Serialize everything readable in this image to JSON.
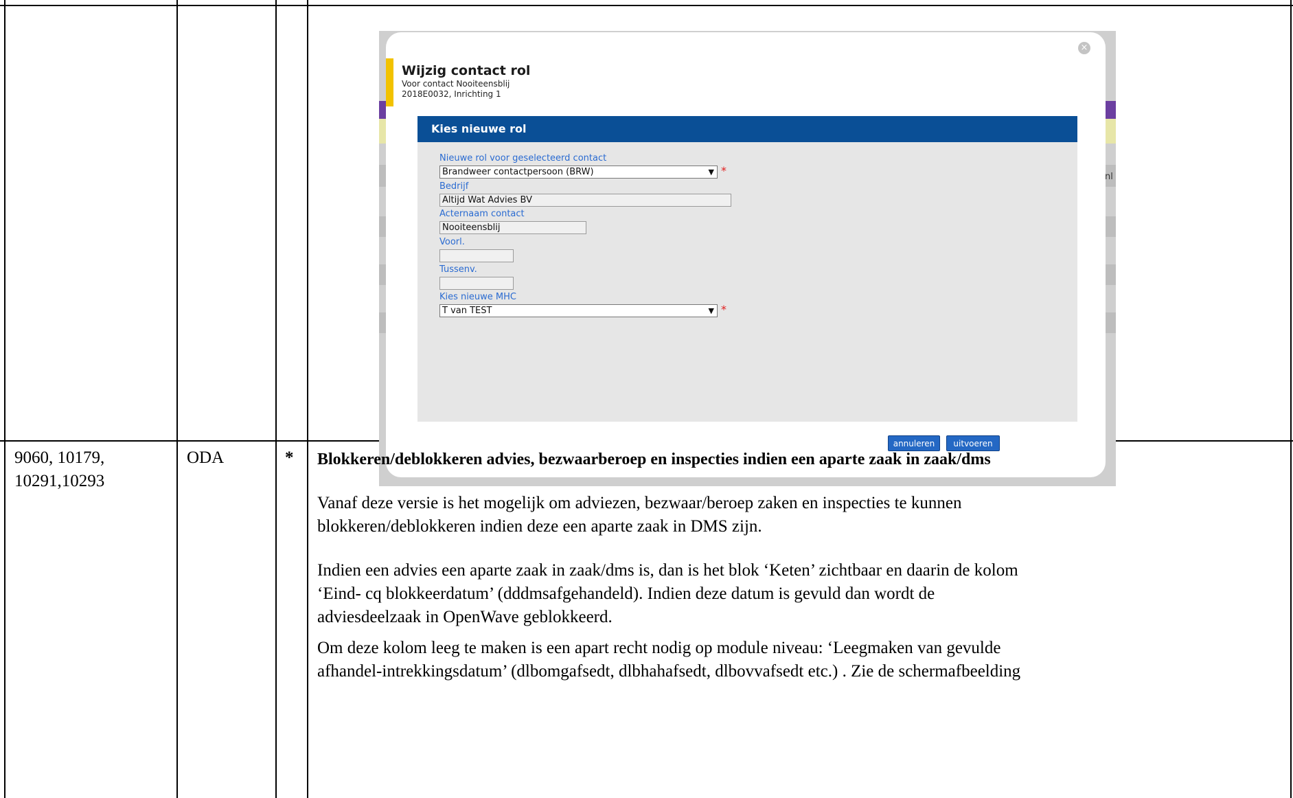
{
  "screenshot": {
    "dialog_title": "Wijzig contact rol",
    "subtitle_line1": "Voor contact Nooiteensblij",
    "subtitle_line2": "2018E0032, Inrichting 1",
    "close_icon": "close-icon",
    "panel_header": "Kies nieuwe rol",
    "fields": {
      "role_label": "Nieuwe rol voor geselecteerd contact",
      "role_value": "Brandweer contactpersoon (BRW)",
      "company_label": "Bedrijf",
      "company_value": "Altijd Wat Advies BV",
      "lastname_label": "Acternaam contact",
      "lastname_value": "Nooiteensblij",
      "initials_label": "Voorl.",
      "initials_value": "",
      "infix_label": "Tussenv.",
      "infix_value": "",
      "mhc_label": "Kies nieuwe MHC",
      "mhc_value": "T van TEST"
    },
    "required_marker": "*",
    "cancel_label": "annuleren",
    "execute_label": "uitvoeren",
    "background_fragment": "nl",
    "colors": {
      "header_blue": "#0a4f96",
      "accent_yellow": "#f2c200",
      "label_blue": "#2a6bd1",
      "stripe_purple": "#6b3fa0"
    }
  },
  "row": {
    "ids_line1": "9060, 10179,",
    "ids_line2": "10291,10293",
    "org": "ODA",
    "marker": "*",
    "heading": "Blokkeren/deblokkeren advies, bezwaarberoep en inspecties indien een aparte zaak in zaak/dms",
    "para1_line1": "Vanaf deze versie is het mogelijk om adviezen, bezwaar/beroep zaken en inspecties te kunnen",
    "para1_line2": "blokkeren/deblokkeren indien deze een aparte zaak in DMS zijn.",
    "para2_line1": "Indien een advies een aparte zaak in zaak/dms is, dan is het blok ‘Keten’ zichtbaar en daarin de kolom",
    "para2_line2": "‘Eind- cq blokkeerdatum’ (dddmsafgehandeld). Indien deze datum is gevuld dan wordt de",
    "para2_line3": "adviesdeelzaak in OpenWave geblokkeerd.",
    "para3_line1": "Om deze kolom leeg te maken is een apart recht nodig op module niveau: ‘Leegmaken van gevulde",
    "para3_line2": "afhandel-intrekkingsdatum’ (dlbomgafsedt, dlbhahafsedt, dlbovvafsedt etc.) . Zie de schermafbeelding"
  }
}
